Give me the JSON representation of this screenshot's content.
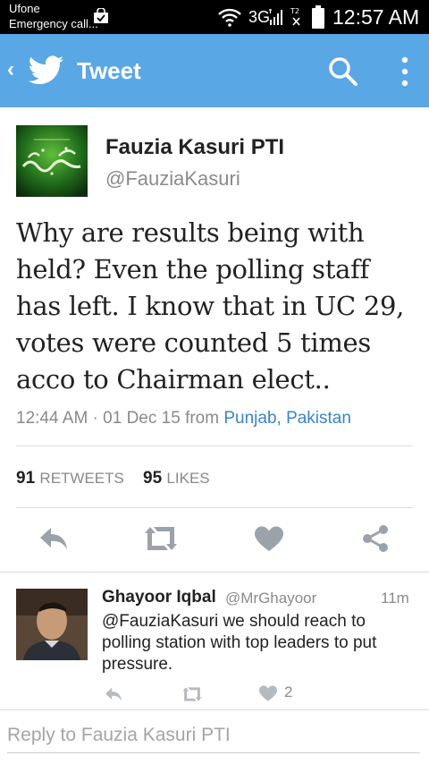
{
  "status_bar": {
    "carrier": "Ufone",
    "emergency": "Emergency call...",
    "network": "3G",
    "time": "12:57 AM"
  },
  "app_bar": {
    "title": "Tweet",
    "icons": [
      "back-chevron",
      "twitter-bird",
      "search",
      "overflow-menu"
    ]
  },
  "tweet": {
    "author_name": "Fauzia Kasuri PTI",
    "author_handle": "@FauziaKasuri",
    "text": "Why are results being with held? Even the polling staff has left. I know that in UC 29, votes were counted 5 times acco to Chairman elect..",
    "timestamp": "12:44 AM · 01 Dec 15",
    "from_label": "from",
    "location": "Punjab, Pakistan",
    "retweets_count": "91",
    "retweets_label": "RETWEETS",
    "likes_count": "95",
    "likes_label": "LIKES"
  },
  "reply": {
    "name": "Ghayoor Iqbal",
    "handle": "@MrGhayoor",
    "time": "11m",
    "text": "@FauziaKasuri we should reach to polling station with top leaders to put pressure.",
    "like_count": "2"
  },
  "composer": {
    "placeholder": "Reply to Fauzia Kasuri PTI",
    "value": ""
  },
  "colors": {
    "accent": "#5aa7e6",
    "link": "#3a84c7",
    "icon_gray": "#9aa3ab",
    "text": "#222222",
    "muted": "#8a8a8a"
  }
}
